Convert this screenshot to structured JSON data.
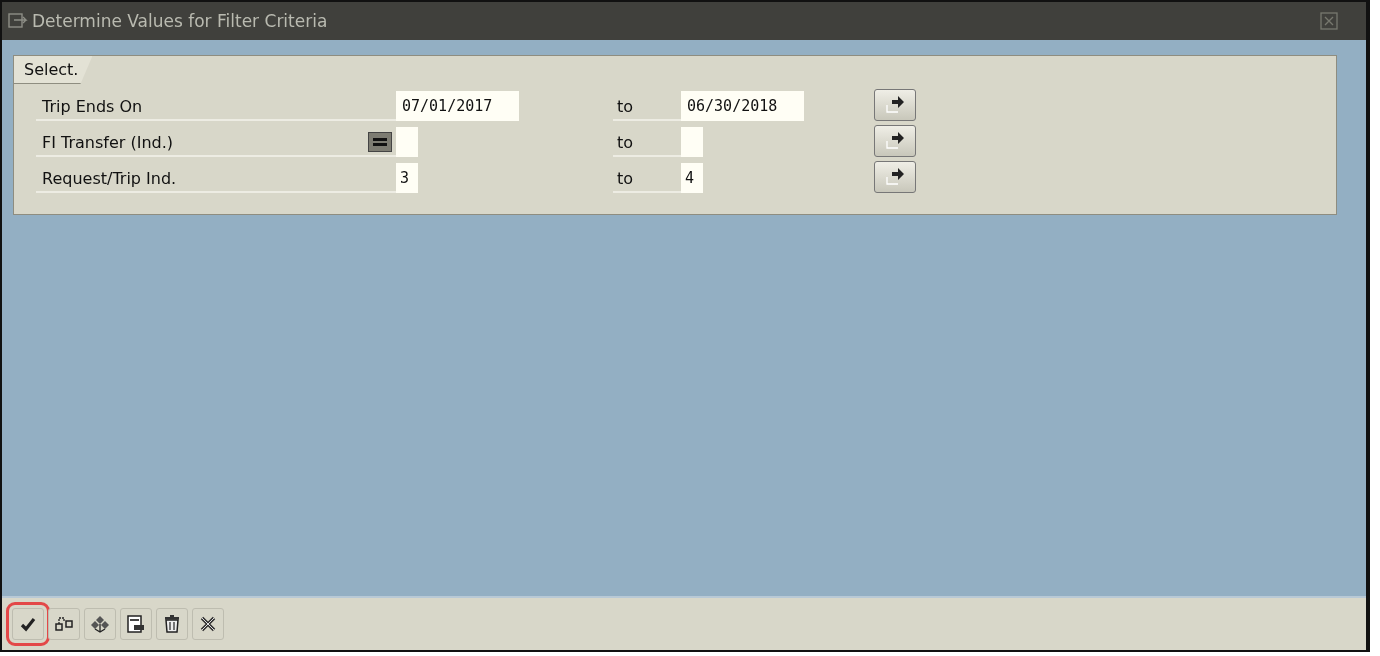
{
  "window": {
    "title": "Determine Values for Filter Criteria"
  },
  "group": {
    "tab": "Select."
  },
  "rows": [
    {
      "label": "Trip Ends On",
      "kind": "date",
      "option": false,
      "from": "07/01/2017",
      "to_label": "to",
      "to": "06/30/2018"
    },
    {
      "label": "FI Transfer (Ind.)",
      "kind": "short",
      "option": true,
      "to_label": "to"
    },
    {
      "label": "Request/Trip Ind.",
      "kind": "short",
      "option": false,
      "from": "3",
      "to_label": "to",
      "to": "4"
    }
  ],
  "toolbar": [
    {
      "highlighted": true
    },
    {
      "highlighted": false
    },
    {
      "highlighted": false
    },
    {
      "highlighted": false
    },
    {
      "highlighted": false
    },
    {
      "highlighted": false
    }
  ]
}
